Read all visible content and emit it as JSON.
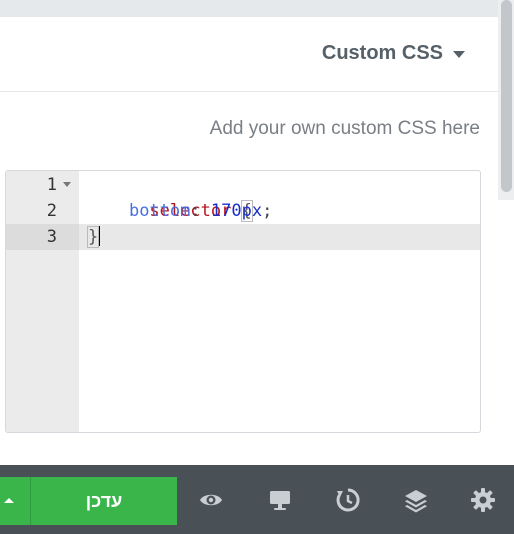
{
  "section": {
    "title": "Custom CSS"
  },
  "description": "Add your own custom CSS here",
  "editor": {
    "lines": [
      {
        "number": "1",
        "selector": "selector",
        "open": "{"
      },
      {
        "number": "2",
        "property": "bottom",
        "colon": ":",
        "value": "170px",
        "semicolon": ";"
      },
      {
        "number": "3",
        "close": "}"
      }
    ]
  },
  "footer": {
    "publish_label": "עדכן",
    "icons": [
      "eye-icon",
      "desktop-icon",
      "history-icon",
      "layers-icon",
      "gear-icon"
    ]
  },
  "colors": {
    "accent_green": "#39b54a",
    "footer_bg": "#495157"
  }
}
